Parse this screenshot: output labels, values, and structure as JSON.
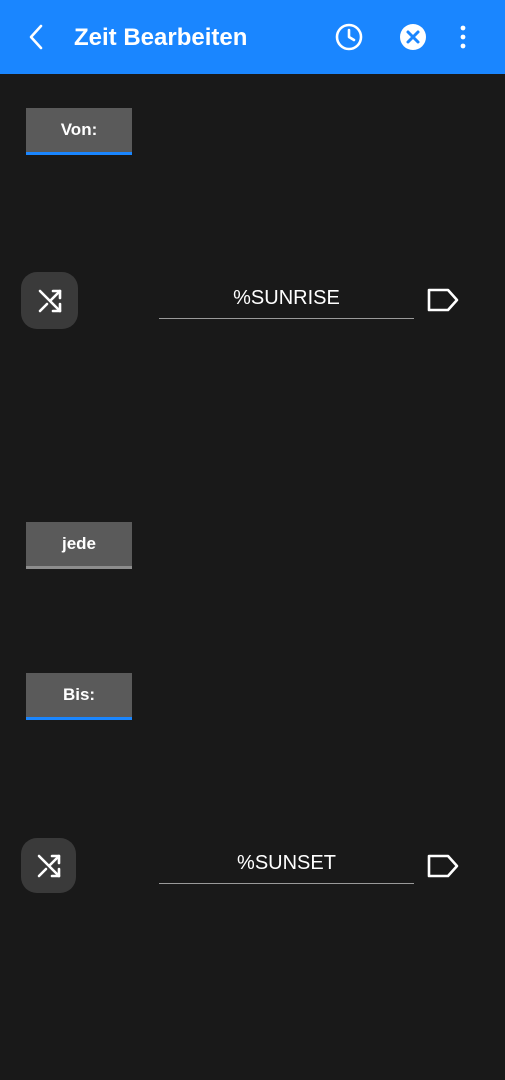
{
  "appbar": {
    "title": "Zeit Bearbeiten",
    "icons": [
      "back-arrow-icon",
      "clock-icon",
      "close-circle-icon",
      "more-vert-icon"
    ],
    "background": "#1a86ff"
  },
  "from": {
    "toggle_label": "Von:",
    "toggle_state": "on",
    "time_value": "%SUNRISE"
  },
  "every": {
    "toggle_label": "jede",
    "toggle_state": "off"
  },
  "to": {
    "toggle_label": "Bis:",
    "toggle_state": "on",
    "time_value": "%SUNSET"
  },
  "colors": {
    "background": "#191919",
    "accent": "#1a86ff",
    "button": "#5a5a5a"
  }
}
